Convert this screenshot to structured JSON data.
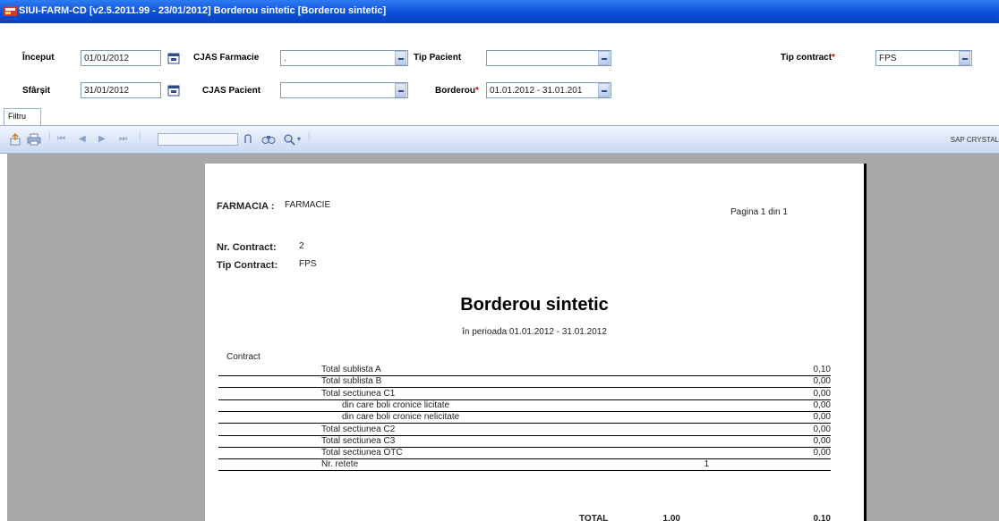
{
  "window": {
    "title": "SIUI-FARM-CD [v2.5.2011.99 - 23/01/2012] Borderou sintetic [Borderou sintetic]"
  },
  "filters": {
    "inceput_label": "Început",
    "inceput_value": "01/01/2012",
    "sfarsit_label": "Sfârșit",
    "sfarsit_value": "31/01/2012",
    "cjas_farmacie_label": "CJAS Farmacie",
    "cjas_farmacie_value": ".",
    "cjas_pacient_label": "CJAS Pacient",
    "cjas_pacient_value": "",
    "tip_pacient_label": "Tip Pacient",
    "tip_pacient_value": "",
    "borderou_label": "Borderou",
    "borderou_value": "01.01.2012 - 31.01.201",
    "tip_contract_label": "Tip contract",
    "tip_contract_value": "FPS"
  },
  "tabs": {
    "filtru": "Filtru"
  },
  "toolbar": {
    "brand": "SAP CRYSTAL"
  },
  "report": {
    "farmacia_label": "FARMACIA :",
    "farmacia_value": "FARMACIE",
    "page_info": "Pagina 1 din 1",
    "nr_contract_label": "Nr. Contract:",
    "nr_contract_value": "2",
    "tip_contract_label": "Tip Contract:",
    "tip_contract_value": "FPS",
    "title": "Borderou sintetic",
    "period": "în perioada  01.01.2012 - 31.01.2012",
    "section_label": "Contract",
    "rows": [
      {
        "label": "Total sublista A",
        "value": "0,10",
        "indent": false,
        "mid": ""
      },
      {
        "label": "Total sublista B",
        "value": "0,00",
        "indent": false,
        "mid": ""
      },
      {
        "label": "Total sectiunea C1",
        "value": "0,00",
        "indent": false,
        "mid": ""
      },
      {
        "label": "din care boli cronice licitate",
        "value": "0,00",
        "indent": true,
        "mid": ""
      },
      {
        "label": "din care boli cronice nelicitate",
        "value": "0,00",
        "indent": true,
        "mid": ""
      },
      {
        "label": "Total sectiunea C2",
        "value": "0,00",
        "indent": false,
        "mid": ""
      },
      {
        "label": "Total sectiunea C3",
        "value": "0,00",
        "indent": false,
        "mid": ""
      },
      {
        "label": "Total sectiunea OTC",
        "value": "0,00",
        "indent": false,
        "mid": ""
      },
      {
        "label": "Nr. retete",
        "value": "",
        "indent": false,
        "mid": "1"
      }
    ],
    "total_label": "TOTAL",
    "total_mid": "1,00",
    "total_value": "0,10"
  },
  "colors": {
    "title_bar": "#0b4fd8",
    "toolbar": "#c9d9f2",
    "viewer_bg": "#a8a8a8",
    "required_mark": "#d40000"
  }
}
